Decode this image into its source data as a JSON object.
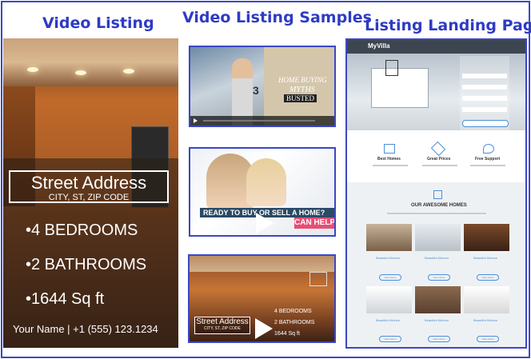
{
  "headings": {
    "left": "Video Listing",
    "middle": "Video Listing Samples",
    "right": "Listing Landing Page"
  },
  "listing": {
    "address_title": "Street Address",
    "address_sub": "CITY, ST, ZIP CODE",
    "bedrooms": "•4 BEDROOMS",
    "bathrooms": "•2 BATHROOMS",
    "sqft": "•1644 Sq ft",
    "contact": "Your Name | +1 (555) 123.1234"
  },
  "samples": {
    "s1_text1": "HOME BUYING",
    "s1_text2": "MYTHS",
    "s1_text3": "BUSTED",
    "s1_number": "3",
    "s2_banner": "READY TO BUY OR SELL A HOME?",
    "s2_help": "CAN HELP",
    "s3_address": "Street Address",
    "s3_sub": "CITY, ST, ZIP CODE",
    "s3_bed": "4 BEDROOMS",
    "s3_bath": "2 BATHROOMS",
    "s3_sqft": "1644 Sq ft"
  },
  "landing": {
    "logo": "MyVilla",
    "features": [
      "Best Homes",
      "Great Prices",
      "Free Support"
    ],
    "homes_title": "OUR AWESOME HOMES",
    "card_title": "Beautiful Kitchen",
    "card_button": "View Home"
  },
  "colors": {
    "accent": "#2e3bc4",
    "border": "#3b47c4",
    "link": "#4a90d9"
  }
}
